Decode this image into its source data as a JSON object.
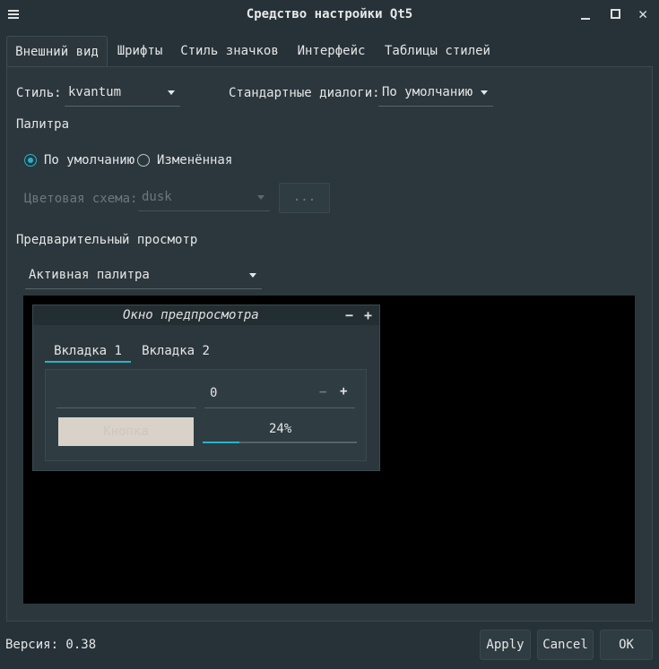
{
  "window": {
    "title": "Средство настройки Qt5"
  },
  "tabs": [
    {
      "label": "Внешний вид"
    },
    {
      "label": "Шрифты"
    },
    {
      "label": "Стиль значков"
    },
    {
      "label": "Интерфейс"
    },
    {
      "label": "Таблицы стилей"
    }
  ],
  "appearance": {
    "style_label": "Стиль:",
    "style_value": "kvantum",
    "dialogs_label": "Стандартные диалоги:",
    "dialogs_value": "По умолчанию",
    "palette_heading": "Палитра",
    "palette_default": "По умолчанию",
    "palette_custom": "Изменённая",
    "color_scheme_label": "Цветовая схема:",
    "color_scheme_value": "dusk",
    "color_scheme_button": "...",
    "preview_heading": "Предварительный просмотр",
    "preview_palette_value": "Активная палитра"
  },
  "preview": {
    "window_title": "Окно предпросмотра",
    "minimize": "−",
    "maximize": "+",
    "tabs": [
      {
        "label": "Вкладка 1"
      },
      {
        "label": "Вкладка 2"
      }
    ],
    "spin_value": "0",
    "spin_minus": "−",
    "spin_plus": "+",
    "button_label": "Кнопка",
    "progress_text": "24%",
    "progress": 0.24
  },
  "footer": {
    "version": "Версия: 0.38",
    "apply": "Apply",
    "cancel": "Cancel",
    "ok": "OK"
  },
  "colors": {
    "accent": "#26b3c9",
    "background": "#263238",
    "panel": "#2b373d"
  }
}
